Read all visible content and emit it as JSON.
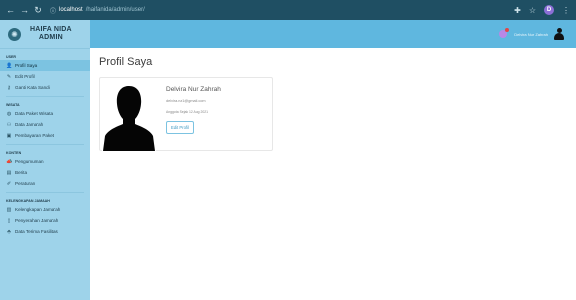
{
  "browser": {
    "url_host": "localhost",
    "url_path": "/haifanida/admin/user/"
  },
  "sidebar": {
    "brand_line1": "HAIFA NIDA",
    "brand_line2": "ADMIN",
    "sections": [
      {
        "label": "USER",
        "items": [
          {
            "label": "Profil Saya",
            "icon": "user-icon",
            "active": true
          },
          {
            "label": "Edit Profil",
            "icon": "user-edit-icon"
          },
          {
            "label": "Ganti Kata Sandi",
            "icon": "key-icon"
          }
        ]
      },
      {
        "label": "WISATA",
        "items": [
          {
            "label": "Data Paket Wisata",
            "icon": "globe-icon"
          },
          {
            "label": "Data Jama'ah",
            "icon": "users-icon"
          },
          {
            "label": "Pembayaran Paket",
            "icon": "money-icon"
          }
        ]
      },
      {
        "label": "KONTEN",
        "items": [
          {
            "label": "Pengumuman",
            "icon": "megaphone-icon"
          },
          {
            "label": "Berita",
            "icon": "newspaper-icon"
          },
          {
            "label": "Peraturan",
            "icon": "pen-icon"
          }
        ]
      },
      {
        "label": "KELENGKAPAN JAMAAH",
        "items": [
          {
            "label": "Kelengkapan Jama'ah",
            "icon": "briefcase-icon"
          },
          {
            "label": "Penyerahan Jama'ah",
            "icon": "document-icon"
          },
          {
            "label": "Data Terima Fasilitas",
            "icon": "gift-icon"
          }
        ]
      }
    ]
  },
  "topbar": {
    "user_name": "Delvira Nur Zahrah"
  },
  "main": {
    "title": "Profil Saya",
    "profile": {
      "name": "Delvira Nur Zahrah",
      "email": "delvira.nz1@gmail.com",
      "member_since": "Anggota Sejak 12 Aug 2021",
      "edit_label": "Edit Profil"
    }
  },
  "colors": {
    "sidebar_bg": "#9ed3ea",
    "topbar_bg": "#5fb7df",
    "active_item": "#7cc3e1"
  }
}
